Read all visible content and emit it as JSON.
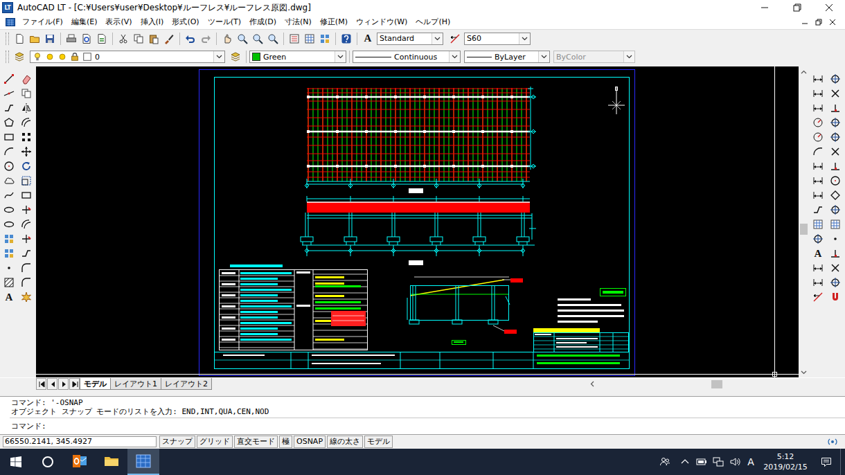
{
  "window": {
    "title": "AutoCAD LT - [C:¥Users¥user¥Desktop¥ルーフレス¥ルーフレス原図.dwg]",
    "app_icon": "LT"
  },
  "menu": [
    "ファイル(F)",
    "編集(E)",
    "表示(V)",
    "挿入(I)",
    "形式(O)",
    "ツール(T)",
    "作成(D)",
    "寸法(N)",
    "修正(M)",
    "ウィンドウ(W)",
    "ヘルプ(H)"
  ],
  "toolbar": {
    "text_style_icon": "A",
    "text_style": "Standard",
    "dim_style": "S60"
  },
  "properties": {
    "layer": "0",
    "color": {
      "label": "Green",
      "color": "#00c000"
    },
    "linetype": "Continuous",
    "lineweight": "ByLayer",
    "plot_style": {
      "label": "ByColor",
      "disabled": true
    }
  },
  "draw_toolbar": {
    "text_icon": "A"
  },
  "dimension_toolbar": {
    "text_icon": "A"
  },
  "layout_tabs": [
    {
      "label": "モデル",
      "selected": true
    },
    {
      "label": "レイアウト1",
      "selected": false
    },
    {
      "label": "レイアウト2",
      "selected": false
    }
  ],
  "command_history": [
    "コマンド: '-OSNAP",
    "オブジェクト スナップ モードのリストを入力: END,INT,QUA,CEN,NOD"
  ],
  "command_prompt": "コマンド:",
  "status_bar": {
    "coordinates": "66550.2141, 345.4927",
    "buttons": [
      "スナップ",
      "グリッド",
      "直交モード",
      "極",
      "OSNAP",
      "線の太さ",
      "モデル"
    ]
  },
  "taskbar": {
    "apps": [
      {
        "selected": false
      },
      {
        "selected": false
      },
      {
        "selected": false
      },
      {
        "selected": true
      }
    ],
    "ime": "A",
    "time": "5:12",
    "date": "2019/02/15"
  }
}
